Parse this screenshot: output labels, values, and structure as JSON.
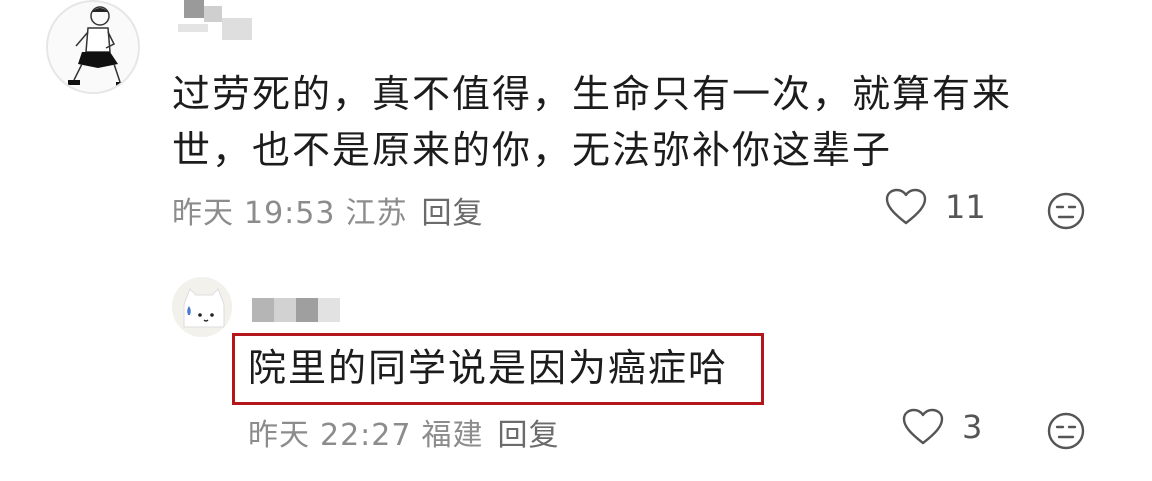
{
  "comments": [
    {
      "text_line1": "过劳死的，真不值得，生命只有一次，就算有来",
      "text_line2": "世，也不是原来的你，无法弥补你这辈子",
      "date": "昨天",
      "time": "19:53",
      "location": "江苏",
      "reply_label": "回复",
      "likes": "11"
    },
    {
      "text": "院里的同学说是因为癌症哈",
      "date": "昨天",
      "time": "22:27",
      "location": "福建",
      "reply_label": "回复",
      "likes": "3"
    }
  ],
  "icons": {
    "like": "heart-outline-icon",
    "emoji": "neutral-face-icon"
  },
  "colors": {
    "highlight_border": "#b3161b",
    "meta_text": "#8c8c8c",
    "body_text": "#1c1c1c"
  }
}
